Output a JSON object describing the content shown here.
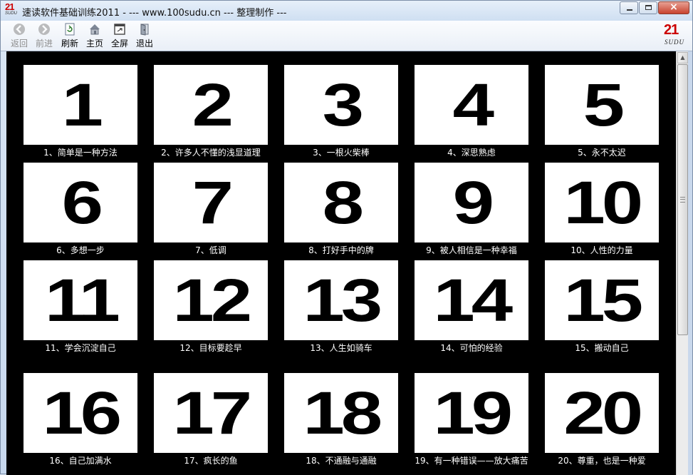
{
  "window": {
    "title": "速读软件基础训练2011 - --- www.100sudu.cn --- 整理制作 ---",
    "logo_main": "21",
    "logo_sub": "SUDU"
  },
  "toolbar": {
    "back_label": "返回",
    "forward_label": "前进",
    "refresh_label": "刷新",
    "home_label": "主页",
    "fullscreen_label": "全屏",
    "exit_label": "退出",
    "brand_main": "21",
    "brand_sub": "SUDU"
  },
  "grid": {
    "items": [
      {
        "number": "1",
        "caption": "1、简单是一种方法"
      },
      {
        "number": "2",
        "caption": "2、许多人不懂的浅显道理"
      },
      {
        "number": "3",
        "caption": "3、一根火柴棒"
      },
      {
        "number": "4",
        "caption": "4、深思熟虑"
      },
      {
        "number": "5",
        "caption": "5、永不太迟"
      },
      {
        "number": "6",
        "caption": "6、多想一步"
      },
      {
        "number": "7",
        "caption": "7、低调"
      },
      {
        "number": "8",
        "caption": "8、打好手中的牌"
      },
      {
        "number": "9",
        "caption": "9、被人相信是一种幸福"
      },
      {
        "number": "10",
        "caption": "10、人性的力量"
      },
      {
        "number": "11",
        "caption": "11、学会沉淀自己"
      },
      {
        "number": "12",
        "caption": "12、目标要趁早"
      },
      {
        "number": "13",
        "caption": "13、人生如骑车"
      },
      {
        "number": "14",
        "caption": "14、可怕的经验"
      },
      {
        "number": "15",
        "caption": "15、搬动自己"
      },
      {
        "number": "16",
        "caption": "16、自己加满水"
      },
      {
        "number": "17",
        "caption": "17、疯长的鱼"
      },
      {
        "number": "18",
        "caption": "18、不通融与通融"
      },
      {
        "number": "19",
        "caption": "19、有一种错误——放大痛苦"
      },
      {
        "number": "20",
        "caption": "20、尊重，也是一种爱"
      }
    ]
  }
}
